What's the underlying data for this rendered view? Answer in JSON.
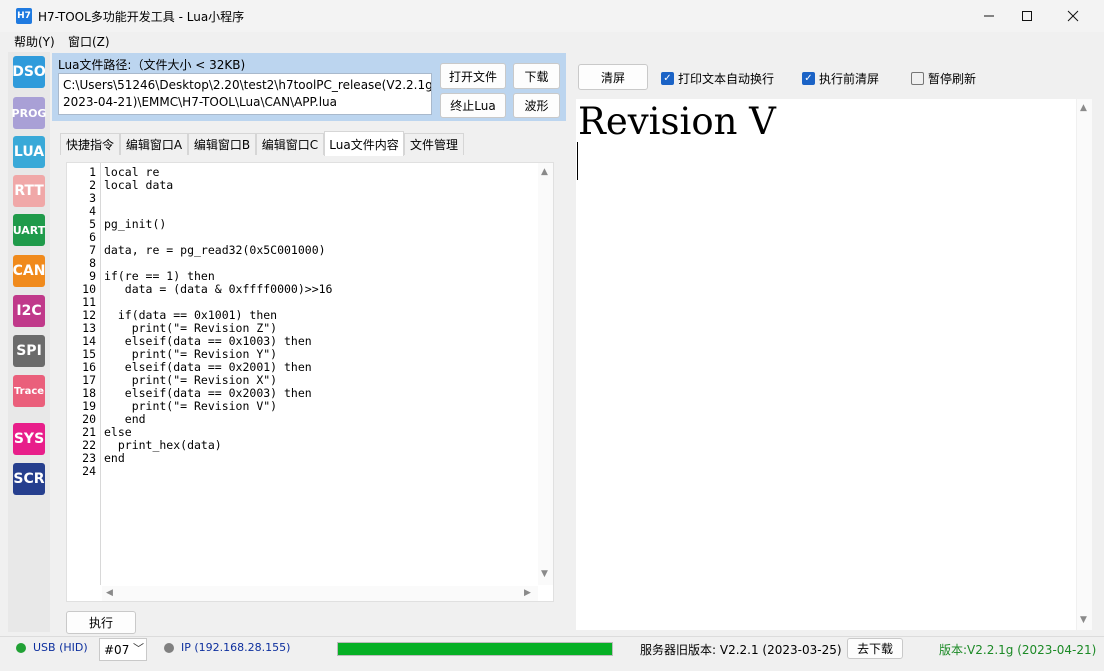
{
  "window": {
    "title": "H7-TOOL多功能开发工具 - Lua小程序",
    "icon_text": "H7"
  },
  "menu": [
    "帮助(Y)",
    "窗口(Z)"
  ],
  "left_tabs": [
    {
      "label": "DSO",
      "color": "#2f9bdb"
    },
    {
      "label": "PROG",
      "color": "#a9a0d6"
    },
    {
      "label": "LUA",
      "color": "#39a9d8"
    },
    {
      "label": "RTT",
      "color": "#f0a8a8"
    },
    {
      "label": "UART",
      "color": "#1f9a4a"
    },
    {
      "label": "CAN",
      "color": "#f08a1c"
    },
    {
      "label": "I2C",
      "color": "#c0398a"
    },
    {
      "label": "SPI",
      "color": "#6b6b6b"
    },
    {
      "label": "Trace",
      "color": "#ea5f7b"
    },
    {
      "label": "SYS",
      "color": "#e81e8a"
    },
    {
      "label": "SCR",
      "color": "#263f8e"
    }
  ],
  "lua_panel": {
    "path_label": "Lua文件路径:（文件大小 < 32KB)",
    "path_value": "C:\\Users\\51246\\Desktop\\2.20\\test2\\h7toolPC_release(V2.2.1g 2023-04-21)\\EMMC\\H7-TOOL\\Lua\\CAN\\APP.lua",
    "open_button": "打开文件",
    "download_button": "下载",
    "stop_button": "终止Lua",
    "wave_button": "波形",
    "run_button": "执行"
  },
  "tabs": [
    "快捷指令",
    "编辑窗口A",
    "编辑窗口B",
    "编辑窗口C",
    "Lua文件内容",
    "文件管理"
  ],
  "active_tab": "Lua文件内容",
  "code_lines": [
    "local re",
    "local data",
    "",
    "",
    "pg_init()",
    "",
    "data, re = pg_read32(0x5C001000)",
    "",
    "if(re == 1) then",
    "   data = (data & 0xffff0000)>>16",
    "",
    "  if(data == 0x1001) then",
    "    print(\"= Revision Z\")",
    "   elseif(data == 0x1003) then",
    "    print(\"= Revision Y\")",
    "   elseif(data == 0x2001) then",
    "    print(\"= Revision X\")",
    "   elseif(data == 0x2003) then",
    "    print(\"= Revision V\")",
    "   end",
    "else",
    "  print_hex(data)",
    "end",
    ""
  ],
  "output_panel": {
    "clear_button": "清屏",
    "auto_wrap_label": "打印文本自动换行",
    "auto_wrap_checked": true,
    "clear_before_run_label": "执行前清屏",
    "clear_before_run_checked": true,
    "pause_refresh_label": "暂停刷新",
    "pause_refresh_checked": false,
    "output_text": "Revision V"
  },
  "status": {
    "usb_text": "USB (HID)",
    "port_value": "#07",
    "ip_text": "IP (192.168.28.155)",
    "progress": 1.0,
    "server_version": "服务器旧版本: V2.2.1 (2023-03-25)",
    "goto_download_button": "去下载",
    "local_version": "版本:V2.2.1g (2023-04-21)",
    "usb_color": "#21a135",
    "ip_color": "#808080",
    "progress_color": "#06b025"
  }
}
